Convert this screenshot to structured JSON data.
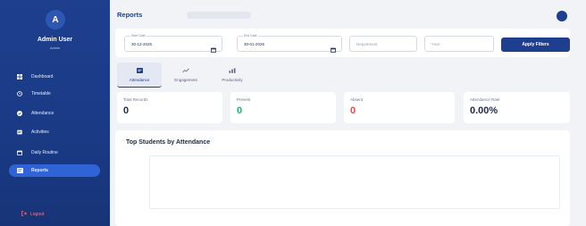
{
  "sidebar": {
    "avatar_initial": "A",
    "admin_name": "Admin User",
    "admin_role": "Admin",
    "items": [
      {
        "label": "Dashboard",
        "icon": "dashboard-icon"
      },
      {
        "label": "Timetable",
        "icon": "clock-icon"
      },
      {
        "label": "Attendance",
        "icon": "check-circle-icon"
      },
      {
        "label": "Activities",
        "icon": "activities-icon"
      },
      {
        "label": "Daily Routine",
        "icon": "calendar-icon"
      },
      {
        "label": "Reports",
        "icon": "reports-icon",
        "active": true
      }
    ],
    "logout_label": "Logout"
  },
  "header": {
    "title": "Reports"
  },
  "filters": {
    "start_date": {
      "label": "Start Date",
      "value": "30-12-2025"
    },
    "end_date": {
      "label": "End Date",
      "value": "30-01-2026"
    },
    "department_placeholder": "Department",
    "year_placeholder": "Year",
    "apply_label": "Apply Filters"
  },
  "tabs": [
    {
      "label": "Attendance",
      "icon": "attendance-icon",
      "active": true
    },
    {
      "label": "Engagement",
      "icon": "engagement-icon"
    },
    {
      "label": "Productivity",
      "icon": "productivity-icon"
    }
  ],
  "stats": [
    {
      "label": "Total Records",
      "value": "0",
      "color": "#1e2a44"
    },
    {
      "label": "Present",
      "value": "0",
      "color": "#22b573"
    },
    {
      "label": "Absent",
      "value": "0",
      "color": "#e5484d"
    },
    {
      "label": "Attendance Rate",
      "value": "0.00%",
      "color": "#1e2a44"
    }
  ],
  "chart": {
    "title": "Top Students by Attendance"
  },
  "colors": {
    "primary": "#1d3f8e",
    "accent": "#2f63d6"
  }
}
